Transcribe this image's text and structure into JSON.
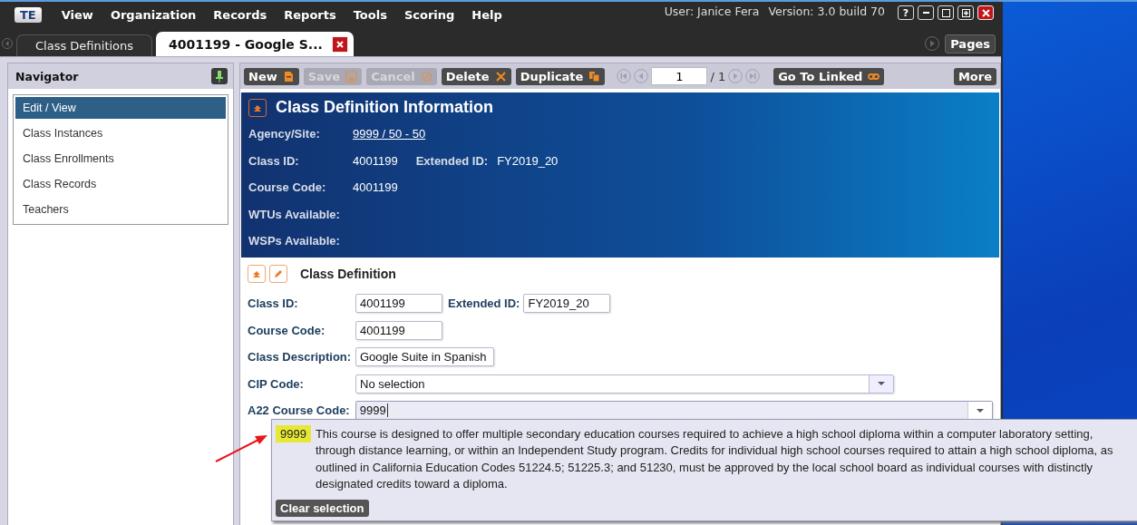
{
  "menubar": {
    "logo": "TE",
    "items": [
      "View",
      "Organization",
      "Records",
      "Reports",
      "Tools",
      "Scoring",
      "Help"
    ],
    "user": "User: Janice Fera",
    "version": "Version: 3.0 build 70",
    "window_buttons": [
      "?"
    ]
  },
  "tabs": [
    {
      "label": "Class Definitions",
      "selected": false
    },
    {
      "label": "4001199 - Google S...",
      "selected": true
    }
  ],
  "pages_button": "Pages",
  "navigator": {
    "title": "Navigator",
    "items": [
      {
        "label": "Edit / View",
        "selected": true
      },
      {
        "label": "Class Instances",
        "selected": false
      },
      {
        "label": "Class Enrollments",
        "selected": false
      },
      {
        "label": "Class Records",
        "selected": false
      },
      {
        "label": "Teachers",
        "selected": false
      }
    ]
  },
  "toolbar": {
    "buttons": [
      {
        "label": "New",
        "disabled": false
      },
      {
        "label": "Save",
        "disabled": true
      },
      {
        "label": "Cancel",
        "disabled": true
      },
      {
        "label": "Delete",
        "disabled": false
      },
      {
        "label": "Duplicate",
        "disabled": false
      }
    ],
    "page": "1",
    "page_total": "/ 1",
    "linked_button": "Go To Linked",
    "more_button": "More"
  },
  "info": {
    "title": "Class Definition Information",
    "rows": [
      {
        "label": "Agency/Site:",
        "value": "9999 / 50 - 50",
        "kind": "link"
      },
      {
        "label": "Class ID:",
        "value": "4001199",
        "extra_label": "Extended ID:",
        "extra_value": "FY2019_20",
        "kind": "text"
      },
      {
        "label": "Course Code:",
        "value": "4001199",
        "kind": "text"
      },
      {
        "label": "WTUs Available:"
      },
      {
        "label": "WSPs Available:"
      }
    ]
  },
  "form": {
    "title": "Class Definition",
    "fields": [
      {
        "label": "Class ID:",
        "kind": "text",
        "value": "4001199",
        "extra_label": "Extended ID:",
        "extra_value": "FY2019_20"
      },
      {
        "label": "Course Code:",
        "kind": "text",
        "value": "4001199"
      },
      {
        "label": "Class Description:",
        "kind": "text",
        "value": "Google Suite in Spanish"
      },
      {
        "label": "CIP Code:",
        "kind": "select",
        "value": "No selection"
      },
      {
        "label": "A22 Course Code:",
        "kind": "combo",
        "value": "9999",
        "expanded": true,
        "option": {
          "code": "9999",
          "description": "This course is designed to offer multiple secondary education courses required to achieve a high school diploma within a computer laboratory setting, through distance learning, or within an Independent Study program. Credits for individual high school courses required to attain a high school diploma, as outlined in California Education Codes 51224.5; 51225.3; and 51230, must be approved by the local school board as individual courses with distinctly designated credits toward a diploma."
        },
        "clear_button": "Clear selection"
      }
    ]
  }
}
